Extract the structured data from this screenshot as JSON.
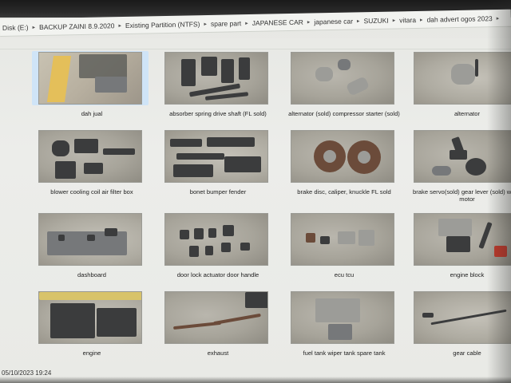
{
  "breadcrumb": [
    {
      "label": "Disk (E:)"
    },
    {
      "label": "BACKUP ZAINI 8.9.2020"
    },
    {
      "label": "Existing Partition (NTFS)"
    },
    {
      "label": "spare part"
    },
    {
      "label": "JAPANESE CAR"
    },
    {
      "label": "japanese car"
    },
    {
      "label": "SUZUKI"
    },
    {
      "label": "vitara"
    },
    {
      "label": "dah advert ogos 2023"
    }
  ],
  "files": [
    {
      "label": "dah jual",
      "selected": true
    },
    {
      "label": "absorber spring drive shaft (FL sold)"
    },
    {
      "label": "alternator (sold) compressor starter (sold)"
    },
    {
      "label": "alternator"
    },
    {
      "label": "blower cooling coil air filter box"
    },
    {
      "label": "bonet bumper fender"
    },
    {
      "label": "brake disc, caliper, knuckle FL sold"
    },
    {
      "label": "brake servo(sold) gear lever (sold) wiper motor"
    },
    {
      "label": "dashboard"
    },
    {
      "label": "door lock actuator door handle"
    },
    {
      "label": "ecu tcu"
    },
    {
      "label": "engine block"
    },
    {
      "label": "engine"
    },
    {
      "label": "exhaust"
    },
    {
      "label": "fuel tank wiper tank spare tank"
    },
    {
      "label": "gear cable"
    }
  ],
  "status": {
    "datetime": "05/10/2023 19:24"
  },
  "colors": {
    "selected_bg": "#cfe4f7",
    "window_bg": "#e9eae6"
  }
}
